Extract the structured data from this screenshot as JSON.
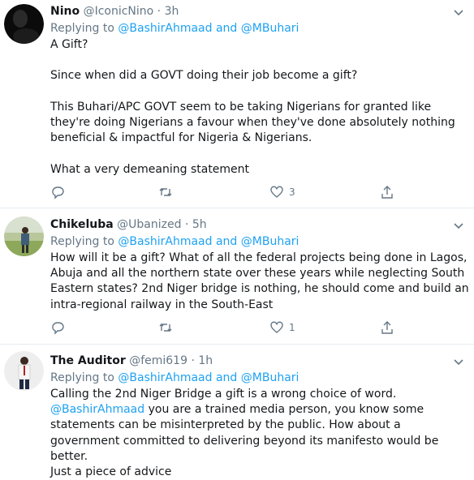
{
  "tweets": [
    {
      "name": "Nino",
      "handle": "@IconicNino",
      "time": "3h",
      "replying_prefix": "Replying to",
      "mentions": "@BashirAhmaad and @MBuhari",
      "body": "A Gift?\n\nSince when did a GOVT doing their job become a gift?\n\nThis Buhari/APC GOVT seem to be taking Nigerians for granted like they're doing Nigerians a favour when they've done absolutely nothing beneficial & impactful for Nigeria & Nigerians.\n\nWhat a very demeaning statement",
      "reply_count": "",
      "retweet_count": "",
      "like_count": "3"
    },
    {
      "name": "Chikeluba",
      "handle": "@Ubanized",
      "time": "5h",
      "replying_prefix": "Replying to",
      "mentions": "@BashirAhmaad and @MBuhari",
      "body": "How will it be a gift? What of all the federal projects being done in Lagos, Abuja and all the northern state over these years while neglecting South Eastern states? 2nd Niger bridge is nothing, he should come and build an intra-regional railway in the South-East",
      "reply_count": "",
      "retweet_count": "",
      "like_count": "1"
    },
    {
      "name": "The Auditor",
      "handle": "@femi619",
      "time": "1h",
      "replying_prefix": "Replying to",
      "mentions": "@BashirAhmaad and @MBuhari",
      "body_intro": "Calling the 2nd Niger Bridge a gift is a wrong choice of word.",
      "body_mention": "@BashirAhmaad",
      "body_rest": "  you are a trained media person, you know some statements can be misinterpreted by the public. How about a government committed to delivering beyond its manifesto would be better.\nJust a piece of advice"
    }
  ],
  "colors": {
    "link": "#1da1f2",
    "muted": "#657786",
    "text": "#14171a"
  },
  "icons": [
    "chevron-down-icon",
    "reply-icon",
    "retweet-icon",
    "like-icon",
    "share-icon"
  ]
}
